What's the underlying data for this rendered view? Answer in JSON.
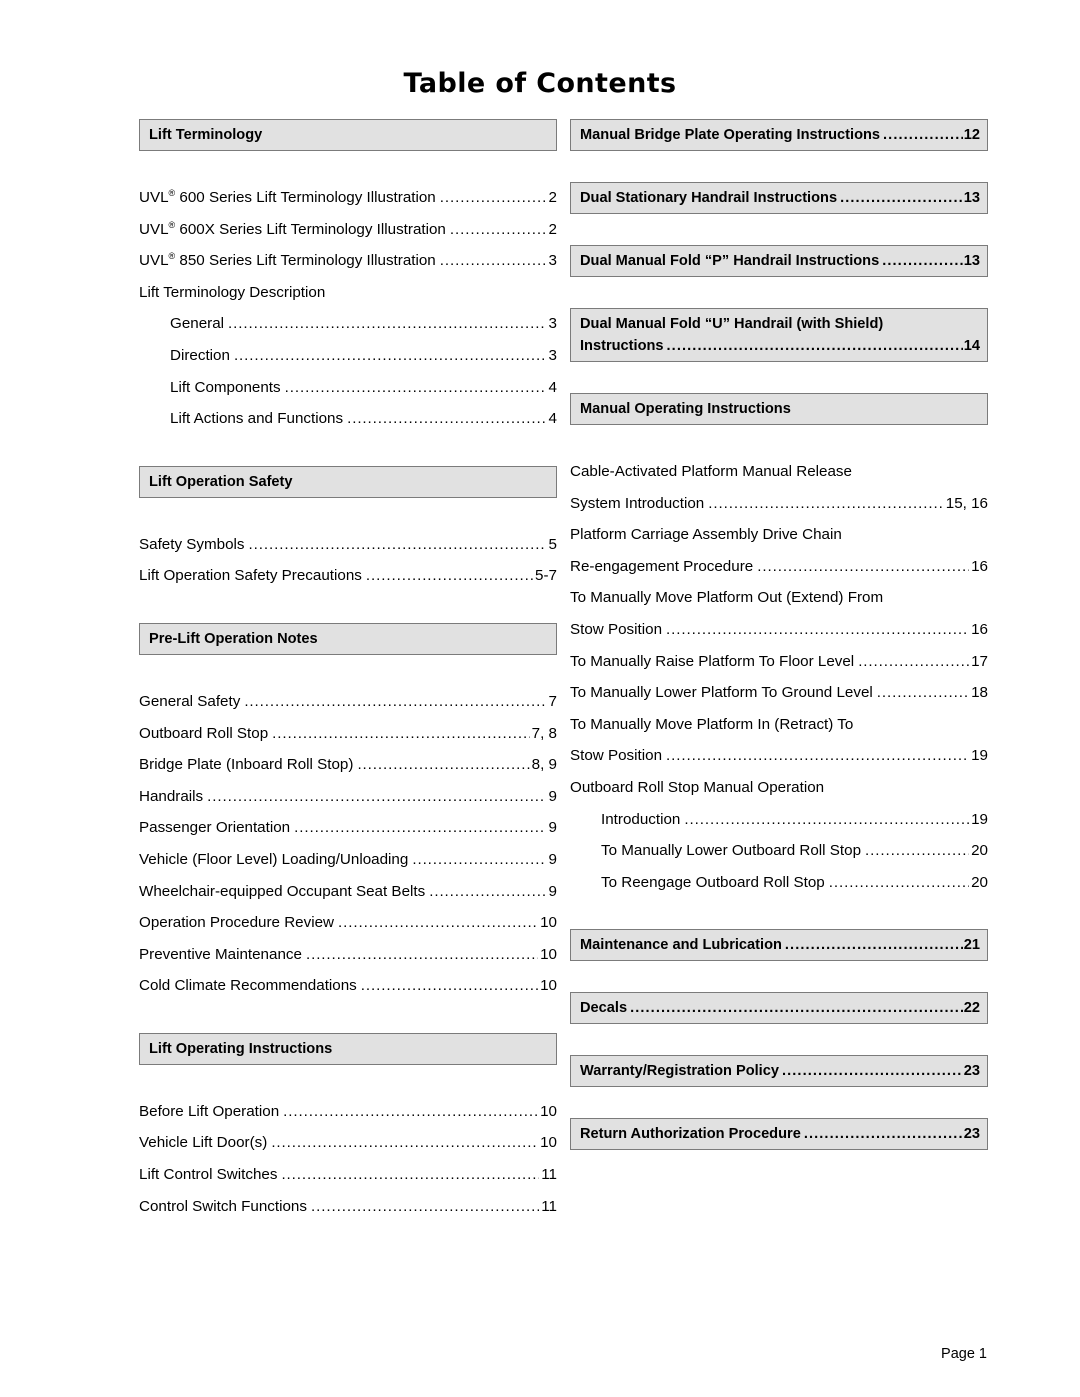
{
  "document": {
    "title": "Table of Contents",
    "footer": "Page 1",
    "accent_bar_fill": "#e1e1e1",
    "accent_bar_border": "#7b7b7b"
  },
  "left_column": {
    "sections": [
      {
        "header": {
          "label": "Lift Terminology",
          "page": ""
        },
        "entries": [
          {
            "label": "UVL® 600 Series Lift Terminology Illustration",
            "page": "2",
            "indent": 0
          },
          {
            "label": "UVL® 600X Series Lift Terminology Illustration",
            "page": "2",
            "indent": 0
          },
          {
            "label": "UVL® 850 Series Lift Terminology Illustration",
            "page": "3",
            "indent": 0
          },
          {
            "label": "Lift Terminology Description",
            "page": "",
            "indent": 0
          },
          {
            "label": "General",
            "page": "3",
            "indent": 1
          },
          {
            "label": "Direction",
            "page": "3",
            "indent": 1
          },
          {
            "label": "Lift Components",
            "page": "4",
            "indent": 1
          },
          {
            "label": "Lift Actions and Functions",
            "page": "4",
            "indent": 1
          }
        ]
      },
      {
        "header": {
          "label": "Lift Operation Safety",
          "page": ""
        },
        "entries": [
          {
            "label": "Safety Symbols",
            "page": "5",
            "indent": 0
          },
          {
            "label": "Lift Operation Safety Precautions",
            "page": "5-7",
            "indent": 0
          }
        ]
      },
      {
        "header": {
          "label": "Pre-Lift Operation Notes",
          "page": ""
        },
        "entries": [
          {
            "label": "General Safety",
            "page": "7",
            "indent": 0
          },
          {
            "label": "Outboard Roll Stop",
            "page": "7, 8",
            "indent": 0
          },
          {
            "label": "Bridge Plate (Inboard Roll Stop)",
            "page": "8, 9",
            "indent": 0
          },
          {
            "label": "Handrails",
            "page": "9",
            "indent": 0
          },
          {
            "label": "Passenger Orientation",
            "page": "9",
            "indent": 0
          },
          {
            "label": "Vehicle (Floor Level) Loading/Unloading",
            "page": "9",
            "indent": 0
          },
          {
            "label": "Wheelchair-equipped Occupant Seat Belts",
            "page": "9",
            "indent": 0
          },
          {
            "label": "Operation Procedure Review",
            "page": "10",
            "indent": 0
          },
          {
            "label": "Preventive Maintenance",
            "page": "10",
            "indent": 0
          },
          {
            "label": "Cold Climate Recommendations",
            "page": "10",
            "indent": 0
          }
        ]
      },
      {
        "header": {
          "label": "Lift Operating Instructions",
          "page": ""
        },
        "entries": [
          {
            "label": "Before Lift Operation",
            "page": "10",
            "indent": 0
          },
          {
            "label": "Vehicle Lift Door(s)",
            "page": "10",
            "indent": 0
          },
          {
            "label": "Lift Control Switches",
            "page": "11",
            "indent": 0
          },
          {
            "label": "Control Switch Functions",
            "page": "11",
            "indent": 0
          }
        ]
      }
    ]
  },
  "right_column": {
    "sections": [
      {
        "header": {
          "label": "Manual Bridge Plate Operating Instructions",
          "page": "12"
        },
        "entries": []
      },
      {
        "header": {
          "label": "Dual Stationary Handrail Instructions",
          "page": "13"
        },
        "entries": []
      },
      {
        "header": {
          "label": "Dual Manual Fold “P” Handrail Instructions",
          "page": "13"
        },
        "entries": []
      },
      {
        "header": {
          "label": "Dual Manual Fold “U” Handrail (with Shield)",
          "label_line2": "Instructions",
          "page": "14"
        },
        "entries": []
      },
      {
        "header": {
          "label": "Manual Operating Instructions",
          "page": ""
        },
        "entries": [
          {
            "label": "Cable-Activated Platform Manual Release",
            "page": "",
            "indent": 0
          },
          {
            "label": "System Introduction",
            "page": "15, 16",
            "indent": 0
          },
          {
            "label": "Platform Carriage Assembly Drive Chain",
            "page": "",
            "indent": 0
          },
          {
            "label": "Re-engagement Procedure",
            "page": "16",
            "indent": 0
          },
          {
            "label": "To Manually Move Platform Out (Extend) From",
            "page": "",
            "indent": 0
          },
          {
            "label": "Stow Position",
            "page": "16",
            "indent": 0
          },
          {
            "label": "To Manually Raise Platform To Floor Level",
            "page": "17",
            "indent": 0
          },
          {
            "label": "To Manually Lower Platform To Ground Level",
            "page": "18",
            "indent": 0
          },
          {
            "label": "To Manually Move Platform In (Retract) To",
            "page": "",
            "indent": 0
          },
          {
            "label": "Stow Position",
            "page": "19",
            "indent": 0
          },
          {
            "label": "Outboard Roll Stop Manual Operation",
            "page": "",
            "indent": 0
          },
          {
            "label": "Introduction",
            "page": "19",
            "indent": 1
          },
          {
            "label": "To Manually Lower Outboard Roll Stop",
            "page": "20",
            "indent": 1
          },
          {
            "label": "To Reengage Outboard Roll Stop",
            "page": "20",
            "indent": 1
          }
        ]
      },
      {
        "header": {
          "label": "Maintenance and Lubrication",
          "page": "21"
        },
        "entries": []
      },
      {
        "header": {
          "label": "Decals",
          "page": "22"
        },
        "entries": []
      },
      {
        "header": {
          "label": "Warranty/Registration Policy",
          "page": "23"
        },
        "entries": []
      },
      {
        "header": {
          "label": "Return Authorization Procedure",
          "page": "23"
        },
        "entries": []
      }
    ]
  }
}
